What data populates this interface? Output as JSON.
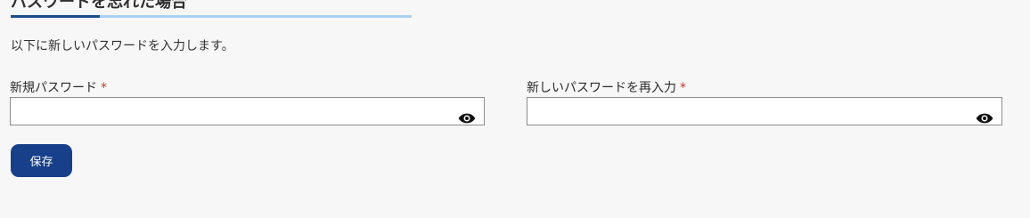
{
  "page": {
    "title": "パスワードを忘れた場合",
    "instruction": "以下に新しいパスワードを入力します。"
  },
  "form": {
    "new_password": {
      "label": "新規パスワード",
      "required_mark": "*",
      "value": "",
      "placeholder": ""
    },
    "confirm_password": {
      "label": "新しいパスワードを再入力",
      "required_mark": "*",
      "value": "",
      "placeholder": ""
    },
    "save_label": "保存"
  },
  "icons": {
    "show_password": "eye-icon"
  },
  "colors": {
    "primary": "#173f8a",
    "title_accent": "#1a4d8c",
    "title_underline": "#a9d2f0",
    "required": "#c0392b",
    "background": "#f6f7f6"
  }
}
